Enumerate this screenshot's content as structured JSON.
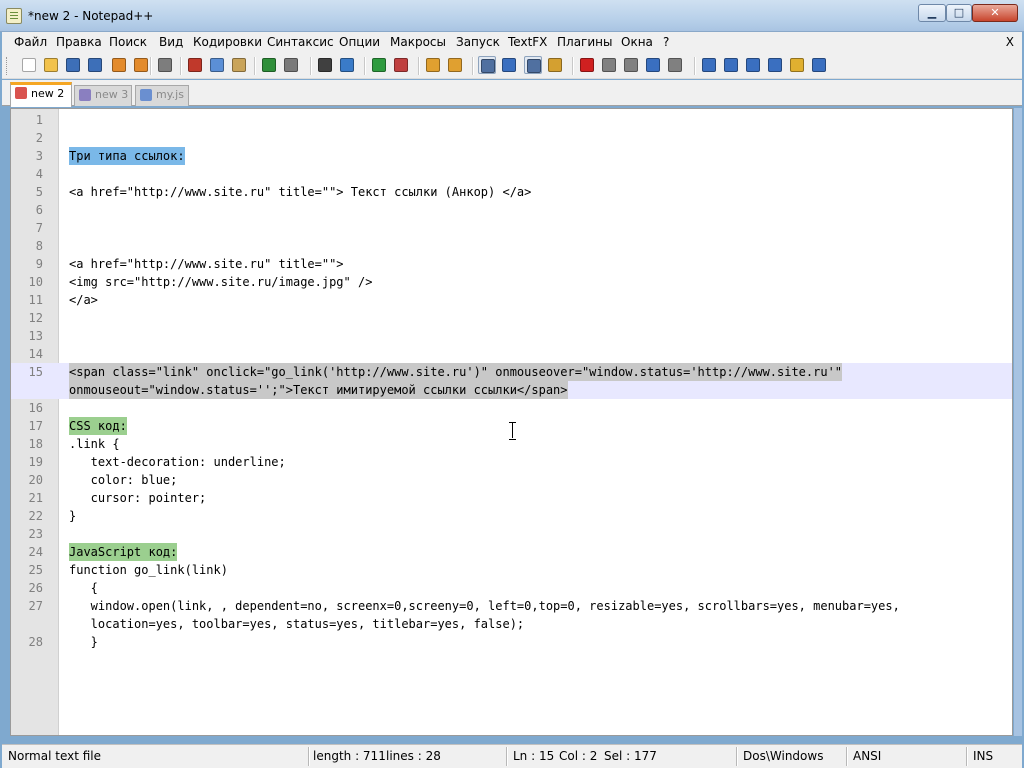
{
  "window": {
    "title": "*new  2 - Notepad++",
    "minimize_label": "▁",
    "maximize_label": "□",
    "close_label": "✕"
  },
  "menu": {
    "items": [
      "Файл",
      "Правка",
      "Поиск",
      "Вид",
      "Кодировки",
      "Синтаксис",
      "Опции",
      "Макросы",
      "Запуск",
      "TextFX",
      "Плагины",
      "Окна",
      "?"
    ],
    "close_doc": "X"
  },
  "toolbar": {
    "buttons": [
      {
        "name": "new-file-icon",
        "color": "#ffffff"
      },
      {
        "name": "open-file-icon",
        "color": "#f2c24b"
      },
      {
        "name": "save-icon",
        "color": "#3d6fb8"
      },
      {
        "name": "save-all-icon",
        "color": "#3d6fb8"
      },
      {
        "name": "close-icon",
        "color": "#e38b2c"
      },
      {
        "name": "close-all-icon",
        "color": "#e38b2c"
      },
      {
        "name": "print-icon",
        "color": "#7d7d7d"
      },
      {
        "name": "cut-icon",
        "color": "#c0392b"
      },
      {
        "name": "copy-icon",
        "color": "#5b8fd6"
      },
      {
        "name": "paste-icon",
        "color": "#c9a45a"
      },
      {
        "name": "undo-icon",
        "color": "#2f8f3a"
      },
      {
        "name": "redo-icon",
        "color": "#7a7a7a"
      },
      {
        "name": "find-icon",
        "color": "#404040"
      },
      {
        "name": "replace-icon",
        "color": "#3a7bc8"
      },
      {
        "name": "zoom-in-icon",
        "color": "#2e9b3f"
      },
      {
        "name": "zoom-out-icon",
        "color": "#c04040"
      },
      {
        "name": "sync-vertical-icon",
        "color": "#e0a030"
      },
      {
        "name": "sync-horizontal-icon",
        "color": "#e0a030"
      },
      {
        "name": "word-wrap-icon",
        "color": "#5070a0"
      },
      {
        "name": "show-all-chars-icon",
        "color": "#3a6fc0"
      },
      {
        "name": "indent-guide-icon",
        "color": "#5070a0"
      },
      {
        "name": "doc-map-icon",
        "color": "#d4a030"
      },
      {
        "name": "record-macro-icon",
        "color": "#d02020"
      },
      {
        "name": "stop-macro-icon",
        "color": "#808080"
      },
      {
        "name": "play-macro-icon",
        "color": "#808080"
      },
      {
        "name": "play-multiple-icon",
        "color": "#3a6fc0"
      },
      {
        "name": "save-macro-icon",
        "color": "#808080"
      },
      {
        "name": "collapse-icon",
        "color": "#3a6fc0"
      },
      {
        "name": "arrow-up-icon",
        "color": "#3a6fc0"
      },
      {
        "name": "arrow-down-icon",
        "color": "#3a6fc0"
      },
      {
        "name": "expand-icon",
        "color": "#3a6fc0"
      },
      {
        "name": "folder-tree-icon",
        "color": "#e0b030"
      },
      {
        "name": "spell-check-icon",
        "color": "#3a6fc0"
      }
    ]
  },
  "tabs": [
    {
      "label": "new  2",
      "active": true,
      "icon_color": "#d9534f"
    },
    {
      "label": "new  3",
      "active": false,
      "icon_color": "#8a7fc0"
    },
    {
      "label": "my.js",
      "active": false,
      "icon_color": "#6a8fd0"
    }
  ],
  "editor": {
    "lines": [
      {
        "n": "1",
        "text": ""
      },
      {
        "n": "2",
        "text": ""
      },
      {
        "n": "3",
        "text": "Три типа ссылок:",
        "hl": "blue"
      },
      {
        "n": "4",
        "text": ""
      },
      {
        "n": "5",
        "text": "<a href=\"http://www.site.ru\" title=\"\"> Текст ссылки (Анкор) </a>"
      },
      {
        "n": "6",
        "text": ""
      },
      {
        "n": "7",
        "text": ""
      },
      {
        "n": "8",
        "text": ""
      },
      {
        "n": "9",
        "text": "<a href=\"http://www.site.ru\" title=\"\">"
      },
      {
        "n": "10",
        "text": "<img src=\"http://www.site.ru/image.jpg\" />"
      },
      {
        "n": "11",
        "text": "</a>"
      },
      {
        "n": "12",
        "text": ""
      },
      {
        "n": "13",
        "text": ""
      },
      {
        "n": "14",
        "text": ""
      },
      {
        "n": "15",
        "text": "<span class=\"link\" onclick=\"go_link('http://www.site.ru')\" onmouseover=\"window.status='http://www.site.ru'\"",
        "hl": "sel",
        "current": true
      },
      {
        "n": "",
        "text": "onmouseout=\"window.status='';\">Текст имитируемой ссылки ссылки</span>",
        "hl": "sel",
        "current": true
      },
      {
        "n": "16",
        "text": ""
      },
      {
        "n": "17",
        "text": "CSS код:",
        "hl": "green"
      },
      {
        "n": "18",
        "text": ".link {"
      },
      {
        "n": "19",
        "text": "   text-decoration: underline;"
      },
      {
        "n": "20",
        "text": "   color: blue;"
      },
      {
        "n": "21",
        "text": "   cursor: pointer;"
      },
      {
        "n": "22",
        "text": "}"
      },
      {
        "n": "23",
        "text": ""
      },
      {
        "n": "24",
        "text": "JavaScript код:",
        "hl": "green"
      },
      {
        "n": "25",
        "text": "function go_link(link)"
      },
      {
        "n": "26",
        "text": "   {"
      },
      {
        "n": "27",
        "text": "   window.open(link, , dependent=no, screenx=0,screeny=0, left=0,top=0, resizable=yes, scrollbars=yes, menubar=yes,"
      },
      {
        "n": "",
        "text": "   location=yes, toolbar=yes, status=yes, titlebar=yes, false);"
      },
      {
        "n": "28",
        "text": "   }"
      }
    ]
  },
  "status": {
    "lang": "Normal text file",
    "length": "length : 711",
    "lines": "lines : 28",
    "ln": "Ln : 15",
    "col": "Col : 2",
    "sel": "Sel : 177",
    "eol": "Dos\\Windows",
    "encoding": "ANSI",
    "mode": "INS"
  }
}
